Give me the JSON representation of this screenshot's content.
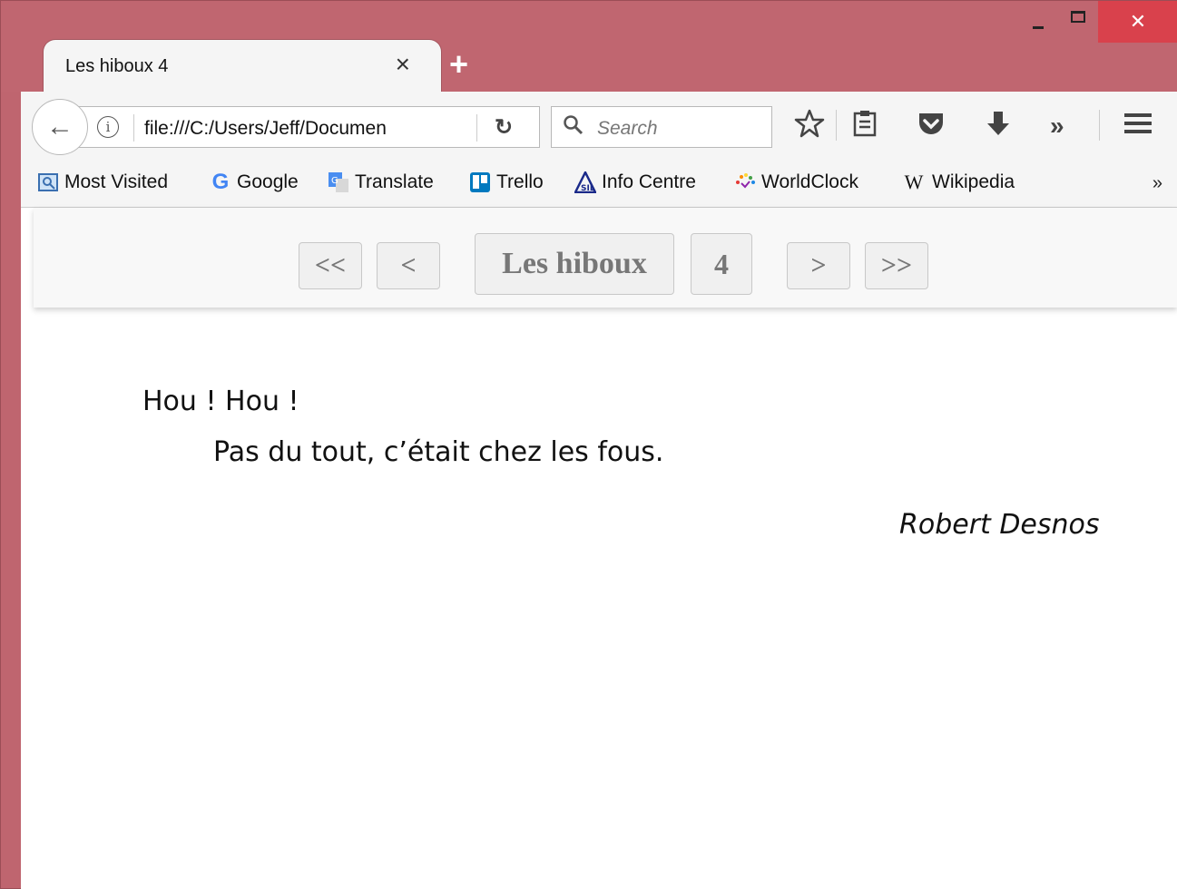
{
  "window": {
    "tab_title": "Les hiboux 4",
    "close_glyph": "×",
    "new_tab_glyph": "+"
  },
  "navbar": {
    "url": "file:///C:/Users/Jeff/Documen",
    "search_placeholder": "Search"
  },
  "bookmarks": [
    {
      "label": "Most Visited",
      "icon": "most-visited-icon"
    },
    {
      "label": "Google",
      "icon": "google-icon"
    },
    {
      "label": "Translate",
      "icon": "translate-icon"
    },
    {
      "label": "Trello",
      "icon": "trello-icon"
    },
    {
      "label": "Info Centre",
      "icon": "info-centre-icon"
    },
    {
      "label": "WorldClock",
      "icon": "worldclock-icon"
    },
    {
      "label": "Wikipedia",
      "icon": "wikipedia-icon"
    }
  ],
  "pager": {
    "first": "<<",
    "prev": "<",
    "title": "Les hiboux",
    "page": "4",
    "next": ">",
    "last": ">>"
  },
  "poem": {
    "line1": "Hou ! Hou !",
    "line2": "Pas du tout, c’était chez les fous.",
    "author": "Robert Desnos"
  },
  "colors": {
    "frame": "#bf656f",
    "close_button": "#d9414c"
  }
}
